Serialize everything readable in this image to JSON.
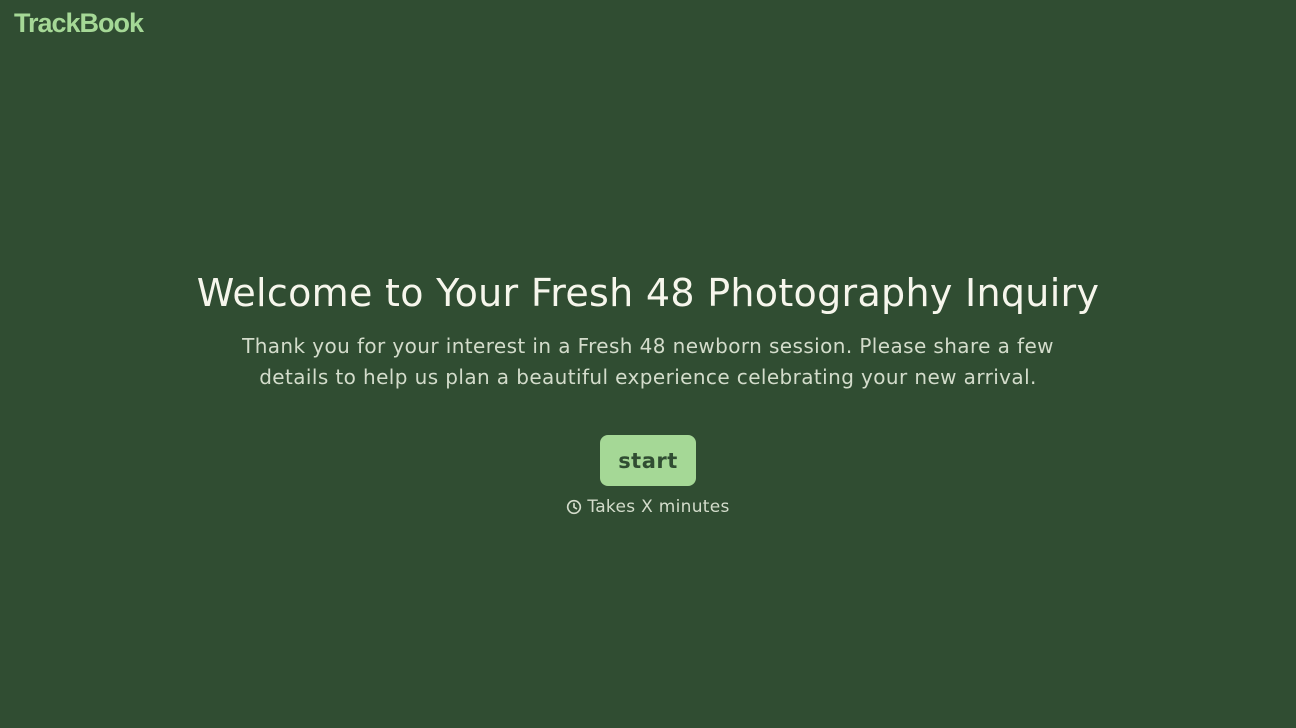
{
  "header": {
    "logo_text": "TrackBook"
  },
  "welcome": {
    "title": "Welcome to Your Fresh 48 Photography Inquiry",
    "description": "Thank you for your interest in a Fresh 48 newborn session. Please share a few details to help us plan a beautiful experience celebrating your new arrival.",
    "start_label": "start",
    "duration_icon": "clock-icon",
    "duration_text": "Takes X minutes"
  },
  "colors": {
    "background": "#304d32",
    "accent": "#a5d896",
    "title_text": "#f6f6ec",
    "body_text": "#d3dccb"
  }
}
